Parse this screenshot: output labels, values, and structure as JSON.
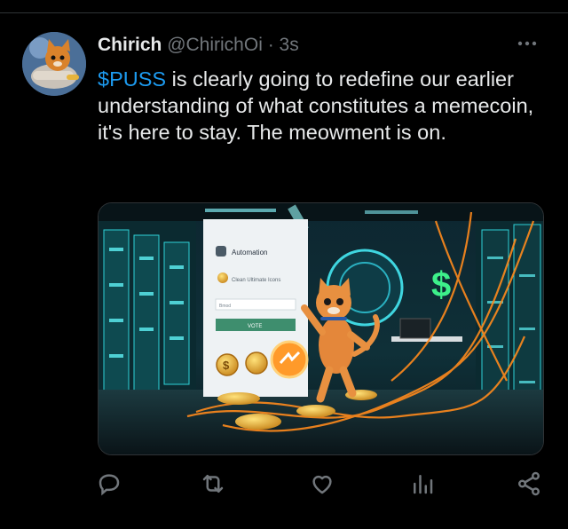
{
  "tweet": {
    "author_name": "Chirich",
    "handle": "@ChirichOi",
    "separator": "·",
    "time": "3s",
    "text_cashtag": "$PUSS",
    "text_body": " is clearly going to redefine our earlier understanding of what constitutes a memecoin, it's here to stay. The meowment is on."
  },
  "media": {
    "panel_title": "Automation",
    "panel_subtitle": "Clean Ultimate Icons",
    "panel_field": "Bmod",
    "panel_button": "VOTE",
    "coin_symbol": "$",
    "neon_sign": "$"
  },
  "icons": {
    "more": "more-icon",
    "reply": "reply-icon",
    "retweet": "retweet-icon",
    "like": "like-icon",
    "views": "views-icon",
    "share": "share-icon"
  },
  "colors": {
    "background": "#000000",
    "text": "#e7e9ea",
    "muted": "#71767b",
    "link": "#1d9bf0"
  }
}
